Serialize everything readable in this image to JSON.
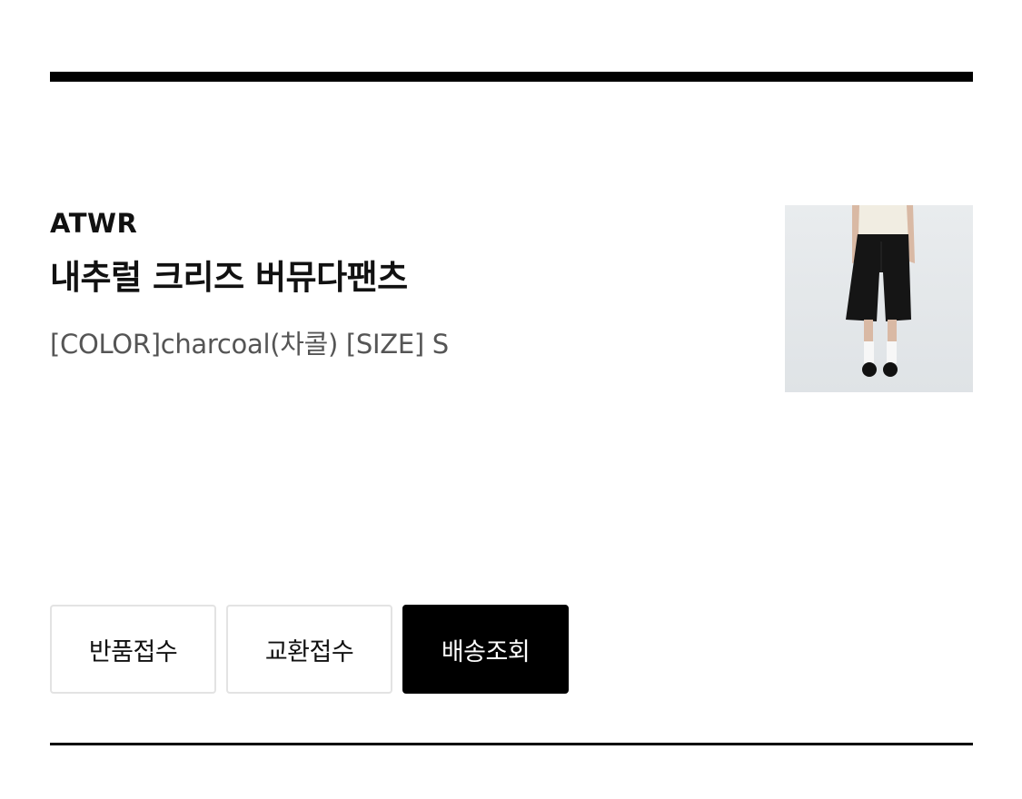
{
  "order_item": {
    "brand": "ATWR",
    "product_name": "내추럴 크리즈 버뮤다팬츠",
    "option": "[COLOR]charcoal(차콜) [SIZE] S",
    "thumbnail": {
      "description_icon": "product-photo"
    }
  },
  "actions": {
    "return_label": "반품접수",
    "exchange_label": "교환접수",
    "tracking_label": "배송조회"
  },
  "colors": {
    "primary_button": "#000000",
    "rule": "#000000",
    "option_text": "#555555",
    "button_border": "#e3e3e3"
  }
}
